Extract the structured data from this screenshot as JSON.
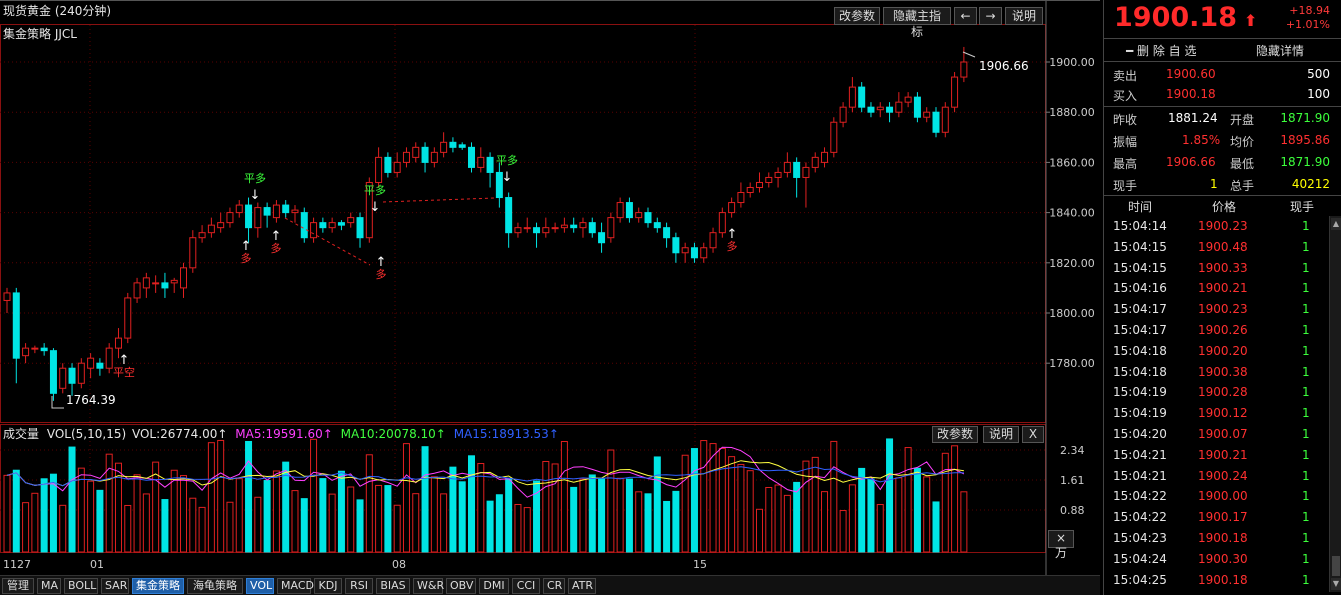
{
  "chart": {
    "title": "现货黄金 (240分钟)",
    "subtitle": "集金策略 JJCL",
    "buttons": [
      "改参数",
      "隐藏主指标",
      "←",
      "→",
      "说明"
    ],
    "y_ticks": [
      "1900.00",
      "1880.00",
      "1860.00",
      "1840.00",
      "1820.00",
      "1800.00",
      "1780.00"
    ],
    "high_label": "1906.66",
    "low_label": "1764.39",
    "x_ticks": [
      "1127",
      "01",
      "08",
      "15"
    ],
    "signals": [
      {
        "text": "平多",
        "color": "#3cff3c"
      },
      {
        "text": "平多",
        "color": "#3cff3c"
      },
      {
        "text": "平多",
        "color": "#3cff3c"
      },
      {
        "text": "多",
        "color": "#ff3030"
      },
      {
        "text": "多",
        "color": "#ff3030"
      },
      {
        "text": "多",
        "color": "#ff3030"
      },
      {
        "text": "多",
        "color": "#ff3030"
      },
      {
        "text": "平空",
        "color": "#ff3030"
      }
    ]
  },
  "volume": {
    "label": "成交量",
    "vol_param": "VOL(5,10,15)",
    "vol_value": "VOL:26774.00↑",
    "ma5": "MA5:19591.60↑",
    "ma10": "MA10:20078.10↑",
    "ma15": "MA15:18913.53↑",
    "buttons": [
      "改参数",
      "说明",
      "X"
    ],
    "y_ticks": [
      "2.34",
      "1.61",
      "0.88"
    ],
    "unit_button": "×万"
  },
  "toolbar": [
    "管理",
    "MA",
    "BOLL",
    "SAR",
    "集金策略",
    "海龟策略",
    "VOL",
    "MACD",
    "KDJ",
    "RSI",
    "BIAS",
    "W&R",
    "OBV",
    "DMI",
    "CCI",
    "CR",
    "ATR"
  ],
  "panel": {
    "price": "1900.18",
    "arrow": "⬆",
    "change": "+18.94",
    "change_pct": "+1.01%",
    "delete_fav": "━ 删 除 自 选",
    "hide_detail": "隐藏详情",
    "sell_label": "卖出",
    "sell_price": "1900.60",
    "sell_qty": "500",
    "buy_label": "买入",
    "buy_price": "1900.18",
    "buy_qty": "100",
    "prev_close_label": "昨收",
    "prev_close": "1881.24",
    "open_label": "开盘",
    "open": "1871.90",
    "amp_label": "振幅",
    "amp": "1.85%",
    "avg_label": "均价",
    "avg": "1895.86",
    "high_label": "最高",
    "high": "1906.66",
    "low_label": "最低",
    "low": "1871.90",
    "cur_label": "现手",
    "cur": "1",
    "total_label": "总手",
    "total": "40212",
    "tick_head": [
      "时间",
      "价格",
      "现手"
    ],
    "ticks": [
      [
        "15:04:14",
        "1900.23",
        "1"
      ],
      [
        "15:04:15",
        "1900.48",
        "1"
      ],
      [
        "15:04:15",
        "1900.33",
        "1"
      ],
      [
        "15:04:16",
        "1900.21",
        "1"
      ],
      [
        "15:04:17",
        "1900.23",
        "1"
      ],
      [
        "15:04:17",
        "1900.26",
        "1"
      ],
      [
        "15:04:18",
        "1900.20",
        "1"
      ],
      [
        "15:04:18",
        "1900.38",
        "1"
      ],
      [
        "15:04:19",
        "1900.28",
        "1"
      ],
      [
        "15:04:19",
        "1900.12",
        "1"
      ],
      [
        "15:04:20",
        "1900.07",
        "1"
      ],
      [
        "15:04:21",
        "1900.21",
        "1"
      ],
      [
        "15:04:21",
        "1900.24",
        "1"
      ],
      [
        "15:04:22",
        "1900.00",
        "1"
      ],
      [
        "15:04:22",
        "1900.17",
        "1"
      ],
      [
        "15:04:23",
        "1900.18",
        "1"
      ],
      [
        "15:04:24",
        "1900.30",
        "1"
      ],
      [
        "15:04:25",
        "1900.18",
        "1"
      ]
    ],
    "colors": {
      "up": "#ff3030",
      "down": "#3cff3c",
      "bull_candle": "#ff3030",
      "bear_candle": "#00e5e5"
    }
  }
}
